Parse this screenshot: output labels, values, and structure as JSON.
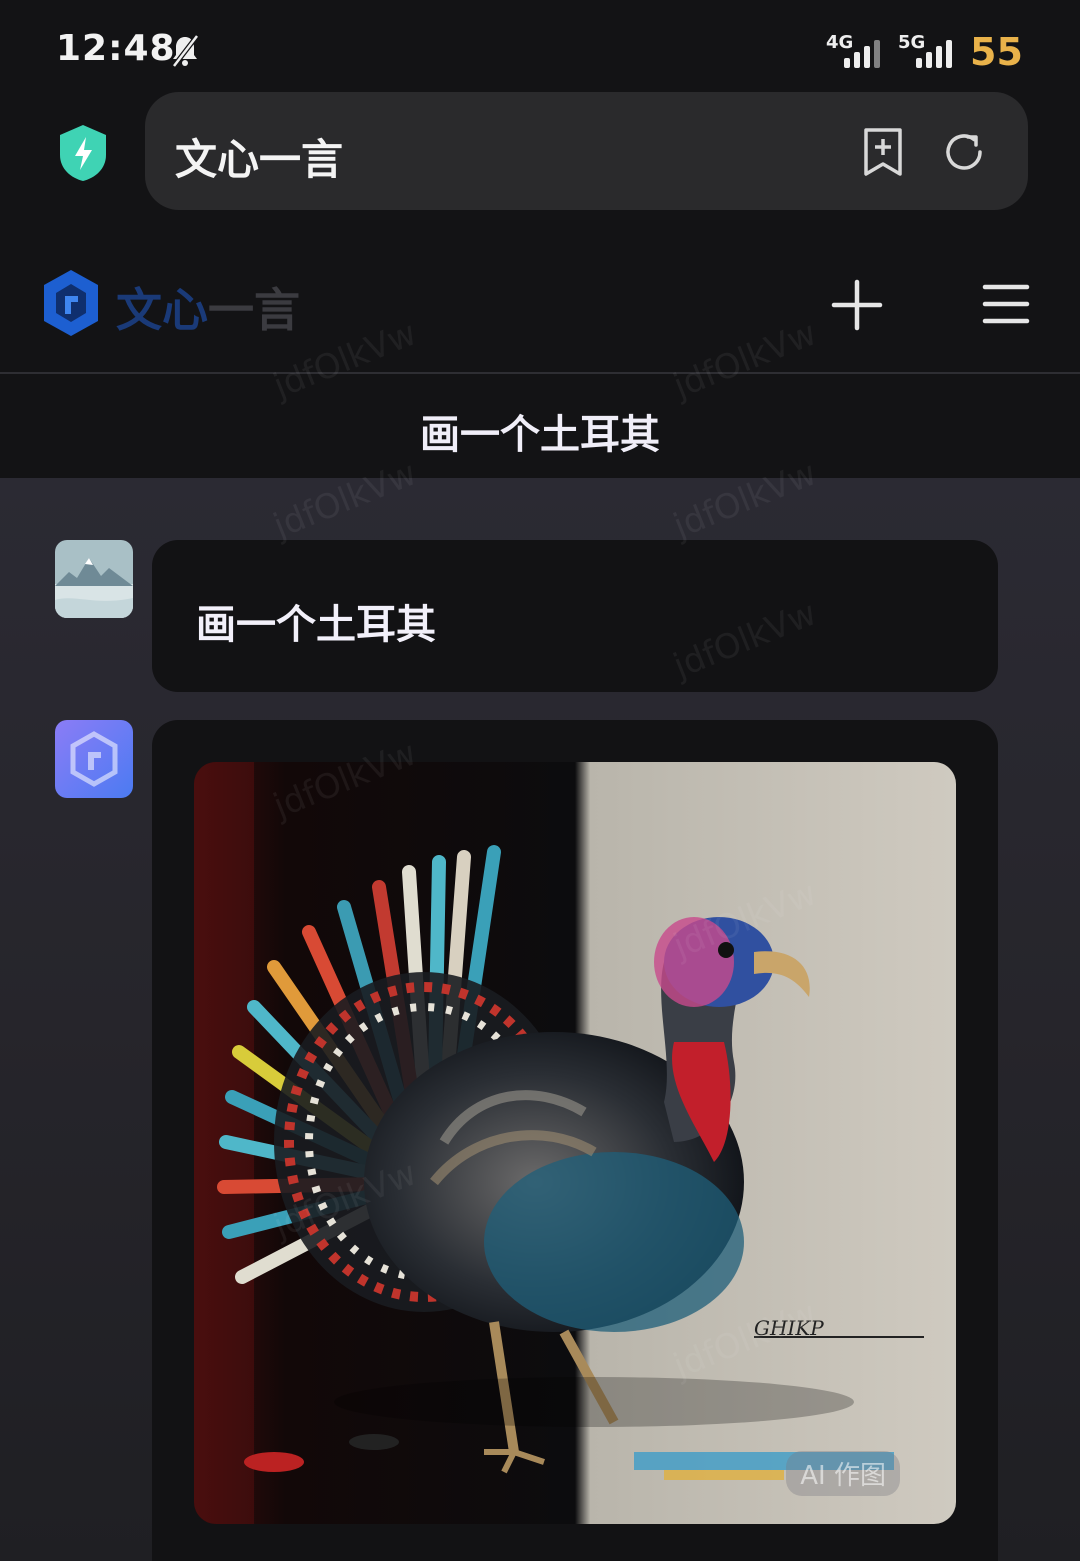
{
  "status_bar": {
    "time": "12:48",
    "signal_1_label": "4G",
    "signal_2_label": "5G",
    "battery": "55",
    "battery_color": "#e9b24a"
  },
  "browser": {
    "url_title": "文心一言"
  },
  "app": {
    "logo_text_blue": "文心",
    "logo_text_gray": "一言",
    "chat_title": "画一个土耳其",
    "accent": "#1a4fb8"
  },
  "conversation": {
    "user_message": "画一个土耳其",
    "image_badge": "AI 作图",
    "image_signature": "GHIKP"
  },
  "watermark_text": "jdfOlkVw"
}
